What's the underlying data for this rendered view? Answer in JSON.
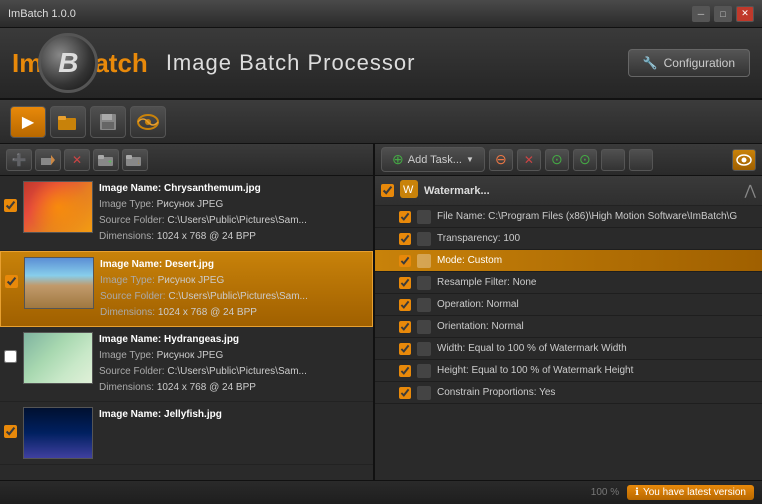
{
  "titlebar": {
    "title": "ImBatch 1.0.0",
    "min_label": "─",
    "max_label": "□",
    "close_label": "✕"
  },
  "header": {
    "logo_letter": "B",
    "logo_left": "Im",
    "logo_right": "atch",
    "app_title": "Image Batch Processor",
    "config_label": "Configuration"
  },
  "toolbar": {
    "buttons": [
      {
        "name": "play",
        "icon": "▶",
        "active": true
      },
      {
        "name": "open-folder",
        "icon": "📁",
        "active": false
      },
      {
        "name": "save",
        "icon": "💾",
        "active": false
      },
      {
        "name": "preview",
        "icon": "👁",
        "active": false
      }
    ]
  },
  "file_panel": {
    "toolbar_buttons": [
      {
        "name": "add-file",
        "icon": "➕",
        "color": "green"
      },
      {
        "name": "remove-file",
        "icon": "➖",
        "color": "orange"
      },
      {
        "name": "delete-file",
        "icon": "✕",
        "color": "red"
      },
      {
        "name": "add-folder",
        "icon": "📂"
      },
      {
        "name": "add-subfolder",
        "icon": "📂"
      }
    ],
    "files": [
      {
        "id": "chrysanthemum",
        "checked": true,
        "thumb_class": "thumb-chrysanthemum",
        "name": "Chrysanthemum.jpg",
        "type": "Рисунок JPEG",
        "source": "C:\\Users\\Public\\Pictures\\Sam...",
        "dimensions": "1024 x 768 @ 24 BPP",
        "selected": false
      },
      {
        "id": "desert",
        "checked": true,
        "thumb_class": "thumb-desert",
        "name": "Desert.jpg",
        "type": "Рисунок JPEG",
        "source": "C:\\Users\\Public\\Pictures\\Sam...",
        "dimensions": "1024 x 768 @ 24 BPP",
        "selected": true
      },
      {
        "id": "hydrangeas",
        "checked": false,
        "thumb_class": "thumb-hydrangeas",
        "name": "Hydrangeas.jpg",
        "type": "Рисунок JPEG",
        "source": "C:\\Users\\Public\\Pictures\\Sam...",
        "dimensions": "1024 x 768 @ 24 BPP",
        "selected": false
      },
      {
        "id": "jellyfish",
        "checked": true,
        "thumb_class": "thumb-jellyfish",
        "name": "Jellyfish.jpg",
        "type": "",
        "source": "",
        "dimensions": "",
        "selected": false,
        "partial": true
      }
    ]
  },
  "task_panel": {
    "add_task_label": "Add Task...",
    "toolbar_buttons": [
      {
        "name": "remove-task",
        "icon": "➖"
      },
      {
        "name": "cancel-task",
        "icon": "✕"
      },
      {
        "name": "up-task",
        "icon": "↑"
      },
      {
        "name": "down-task",
        "icon": "↓"
      }
    ],
    "tasks": [
      {
        "type": "header",
        "checked": true,
        "icon": "🔖",
        "label": "Watermark...",
        "expanded": true
      },
      {
        "type": "item",
        "checked": true,
        "label": "File Name: C:\\Program Files (x86)\\High Motion Software\\ImBatch\\G",
        "highlighted": false
      },
      {
        "type": "item",
        "checked": true,
        "label": "Transparency: 100",
        "highlighted": false
      },
      {
        "type": "item",
        "checked": true,
        "label": "Mode: Custom",
        "highlighted": true
      },
      {
        "type": "item",
        "checked": true,
        "label": "Resample Filter: None",
        "highlighted": false
      },
      {
        "type": "item",
        "checked": true,
        "label": "Operation: Normal",
        "highlighted": false
      },
      {
        "type": "item",
        "checked": true,
        "label": "Orientation: Normal",
        "highlighted": false
      },
      {
        "type": "item",
        "checked": true,
        "label": "Width: Equal to 100 % of Watermark Width",
        "highlighted": false
      },
      {
        "type": "item",
        "checked": true,
        "label": "Height: Equal to 100 % of Watermark Height",
        "highlighted": false
      },
      {
        "type": "item",
        "checked": true,
        "label": "Constrain Proportions: Yes",
        "highlighted": false
      }
    ]
  },
  "status_bar": {
    "zoom_label": "100 %",
    "version_label": "You have latest version"
  }
}
